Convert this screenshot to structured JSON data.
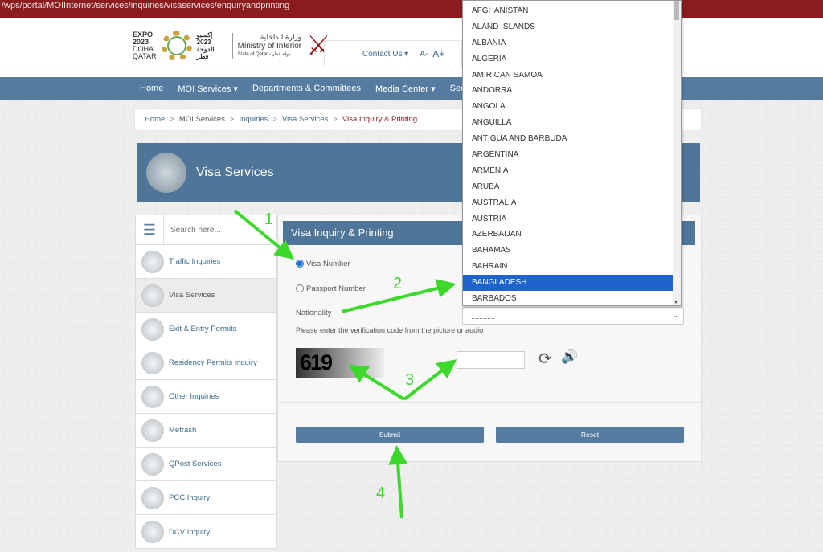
{
  "url": "/wps/portal/MOIInternet/services/inquiries/visaservices/enquiryandprinting",
  "header": {
    "expo": [
      "EXPO",
      "2023",
      "DOHA",
      "QATAR"
    ],
    "expo_ar": "إكسبو 2023 الدوحة قطر",
    "ministry_ar": "وزارة الداخلية",
    "ministry": "Ministry of Interior",
    "state": "State of Qatar - دولة قطر",
    "contact": "Contact Us ▾",
    "font_minus": "A-",
    "font_plus": "A+"
  },
  "nav": [
    "Home",
    "MOI Services ▾",
    "Departments & Committees",
    "Media Center ▾",
    "Secu"
  ],
  "breadcrumb": [
    "Home",
    "MOI Services",
    "Inquiries",
    "Visa Services",
    "Visa Inquiry & Printing"
  ],
  "banner_title": "Visa Services",
  "sidebar": {
    "search_placeholder": "Search here...",
    "items": [
      "Traffic Inquiries",
      "Visa Services",
      "Exit & Entry Permits",
      "Residency Permits inquiry",
      "Other Inquiries",
      "Metrash",
      "QPost Services",
      "PCC Inquiry",
      "DCV Inquiry"
    ],
    "active": 1
  },
  "form": {
    "title": "Visa Inquiry & Printing",
    "radio_visa": "Visa Number",
    "radio_passport": "Passport Number",
    "selected_radio": "Visa Number",
    "nationality_label": "Nationality",
    "nationality_value": "............",
    "verify_text": "Please enter the verification code from the picture or audio",
    "captcha": "619",
    "submit": "Submit",
    "reset": "Reset"
  },
  "dropdown": {
    "options": [
      "AFGHANISTAN",
      "ALAND ISLANDS",
      "ALBANIA",
      "ALGERIA",
      "AMIRICAN SAMOA",
      "ANDORRA",
      "ANGOLA",
      "ANGUILLA",
      "ANTIGUA AND BARBUDA",
      "ARGENTINA",
      "ARMENIA",
      "ARUBA",
      "AUSTRALIA",
      "AUSTRIA",
      "AZERBAIJAN",
      "BAHAMAS",
      "BAHRAIN",
      "BANGLADESH",
      "BARBADOS"
    ],
    "selected": "BANGLADESH"
  },
  "annotations": [
    "1",
    "2",
    "3",
    "4"
  ],
  "colors": {
    "url_bar": "#8a1c1f",
    "nav": "#557ca0",
    "accent": "#4f7599",
    "arrow": "#3cd82c",
    "selected": "#1e64cc"
  }
}
